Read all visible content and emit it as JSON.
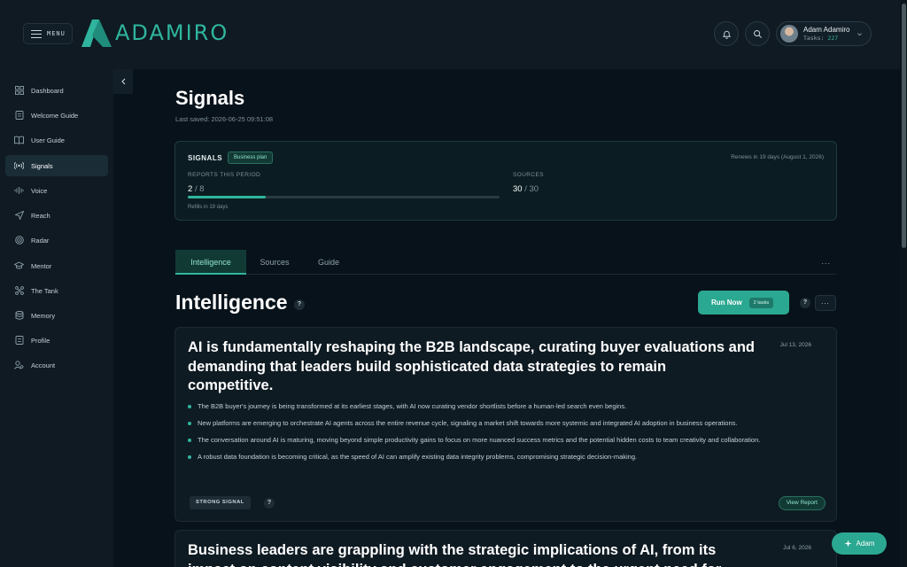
{
  "header": {
    "menu_label": "MENU",
    "logo_text": "ADAMIRO",
    "user": {
      "name": "Adam Adamiro",
      "tasks_label": "Tasks:",
      "tasks_count": "227"
    }
  },
  "sidebar": {
    "items": [
      {
        "label": "Dashboard",
        "icon": "dashboard-icon"
      },
      {
        "label": "Welcome Guide",
        "icon": "document-icon"
      },
      {
        "label": "User Guide",
        "icon": "book-icon"
      },
      {
        "label": "Signals",
        "icon": "signal-icon",
        "active": true
      },
      {
        "label": "Voice",
        "icon": "waveform-icon"
      },
      {
        "label": "Reach",
        "icon": "send-icon"
      },
      {
        "label": "Radar",
        "icon": "target-icon"
      },
      {
        "label": "Mentor",
        "icon": "graduation-cap-icon"
      },
      {
        "label": "The Tank",
        "icon": "network-icon"
      },
      {
        "label": "Memory",
        "icon": "database-icon"
      },
      {
        "label": "Profile",
        "icon": "profile-icon"
      },
      {
        "label": "Account",
        "icon": "account-icon"
      }
    ]
  },
  "page": {
    "title": "Signals",
    "last_saved": "Last saved: 2026-06-25 09:51:08"
  },
  "plan_card": {
    "title": "SIGNALS",
    "badge": "Business plan",
    "renewal": "Renews in 19 days (August 1, 2026)",
    "reports_label": "REPORTS THIS PERIOD",
    "reports_used": "2",
    "reports_total": "/ 8",
    "reports_fraction": 0.25,
    "refill": "Refills in 19 days",
    "sources_label": "SOURCES",
    "sources_used": "30",
    "sources_total": "/ 30"
  },
  "tabs": [
    {
      "label": "Intelligence",
      "active": true
    },
    {
      "label": "Sources"
    },
    {
      "label": "Guide"
    }
  ],
  "tabs_more": "...",
  "section": {
    "title": "Intelligence",
    "help": "?",
    "run_label": "Run Now",
    "run_tasks": "2 tasks",
    "more": "..."
  },
  "reports": [
    {
      "title": "AI is fundamentally reshaping the B2B landscape, curating buyer evaluations and demanding that leaders build sophisticated data strategies to remain competitive.",
      "date": "Jul 13, 2026",
      "bullets": [
        "The B2B buyer's journey is being transformed at its earliest stages, with AI now curating vendor shortlists before a human-led search even begins.",
        "New platforms are emerging to orchestrate AI agents across the entire revenue cycle, signaling a market shift towards more systemic and integrated AI adoption in business operations.",
        "The conversation around AI is maturing, moving beyond simple productivity gains to focus on more nuanced success metrics and the potential hidden costs to team creativity and collaboration.",
        "A robust data foundation is becoming critical, as the speed of AI can amplify existing data integrity problems, compromising strategic decision-making."
      ],
      "signal": "STRONG SIGNAL",
      "view_label": "View Report"
    },
    {
      "title": "Business leaders are grappling with the strategic implications of AI, from its impact on content visibility and customer engagement to the urgent need for",
      "date": "Jul 6, 2026"
    }
  ],
  "assistant": {
    "label": "Adam"
  },
  "colors": {
    "accent": "#2fb59e",
    "background": "#08121a",
    "sidebar": "#0f1a22"
  }
}
